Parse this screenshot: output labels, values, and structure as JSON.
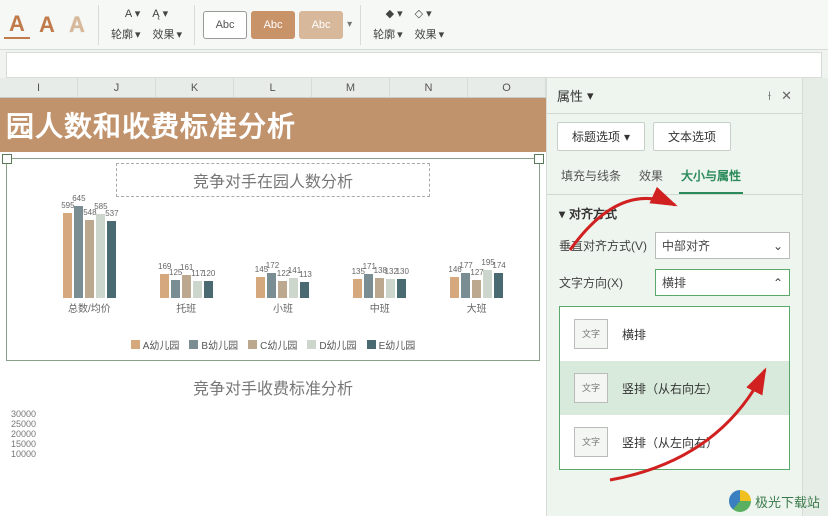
{
  "ribbon": {
    "outline": "轮廓",
    "effects": "效果",
    "abc": "Abc"
  },
  "columns": [
    "I",
    "J",
    "K",
    "L",
    "M",
    "N",
    "O"
  ],
  "banner_title": "园人数和收费标准分析",
  "chart_data": [
    {
      "type": "bar",
      "title": "竞争对手在园人数分析",
      "categories": [
        "总数/均价",
        "托班",
        "小班",
        "中班",
        "大班"
      ],
      "series": [
        {
          "name": "A幼儿园",
          "color": "#d5a87d",
          "values": [
            595,
            169,
            145,
            135,
            146
          ]
        },
        {
          "name": "B幼儿园",
          "color": "#7a8d92",
          "values": [
            645,
            125,
            172,
            171,
            177
          ]
        },
        {
          "name": "C幼儿园",
          "color": "#bca88e",
          "values": [
            548,
            161,
            122,
            138,
            127
          ]
        },
        {
          "name": "D幼儿园",
          "color": "#cdd6cc",
          "values": [
            585,
            117,
            141,
            132,
            195
          ]
        },
        {
          "name": "E幼儿园",
          "color": "#4a6a72",
          "values": [
            537,
            120,
            113,
            130,
            174
          ]
        }
      ],
      "xlabel": "",
      "ylabel": "",
      "ylim": [
        0,
        700
      ]
    },
    {
      "type": "bar",
      "title": "竞争对手收费标准分析",
      "categories": [],
      "yticks": [
        30000,
        25000,
        20000,
        15000,
        10000
      ],
      "series": [],
      "xlabel": "",
      "ylabel": "",
      "ylim": [
        0,
        30000
      ]
    }
  ],
  "panel": {
    "title": "属性",
    "tab_title_options": "标题选项",
    "tab_text_options": "文本选项",
    "tab_fill_line": "填充与线条",
    "tab_effects": "效果",
    "tab_size_prop": "大小与属性",
    "section_align": "对齐方式",
    "vert_align_label": "垂直对齐方式(V)",
    "vert_align_value": "中部对齐",
    "text_dir_label": "文字方向(X)",
    "text_dir_value": "横排",
    "options": {
      "horizontal": "横排",
      "vertical_rtl": "竖排（从右向左）",
      "vertical_ltr": "竖排（从左向右）"
    },
    "icon_h": "文字",
    "icon_v": "文字"
  },
  "watermark": "极光下载站"
}
